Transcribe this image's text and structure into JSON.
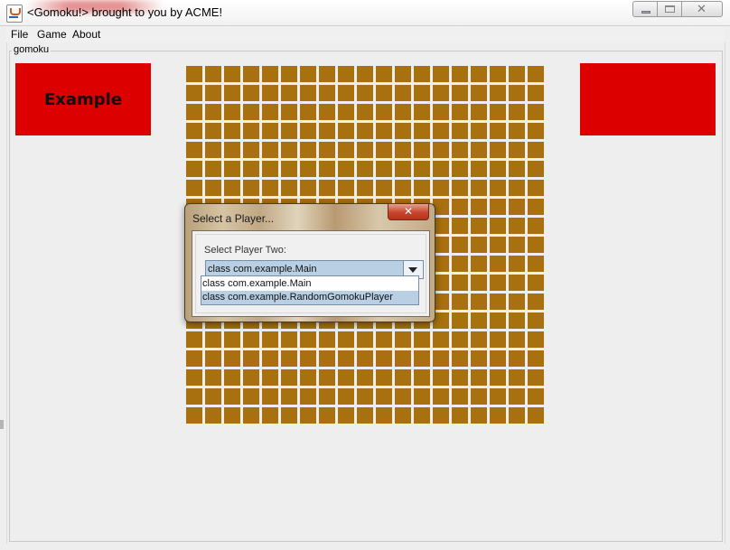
{
  "window": {
    "title": "<Gomoku!> brought to you by ACME!",
    "close_glyph": "✕"
  },
  "menu": {
    "items": [
      {
        "label": "File"
      },
      {
        "label": "Game"
      },
      {
        "label": "About"
      }
    ]
  },
  "group": {
    "label": "gomoku"
  },
  "players": {
    "left": {
      "label": "Example",
      "color": "#dd0000"
    },
    "right": {
      "label": "",
      "color": "#dd0000"
    }
  },
  "board": {
    "rows": 19,
    "cols": 19,
    "cell_color": "#a8700e"
  },
  "dialog": {
    "title": "Select a Player...",
    "close_glyph": "✕",
    "prompt": "Select Player Two:",
    "selected_value": "class com.example.Main",
    "options": [
      "class com.example.Main",
      "class com.example.RandomGomokuPlayer"
    ],
    "highlighted_option_index": 1
  }
}
